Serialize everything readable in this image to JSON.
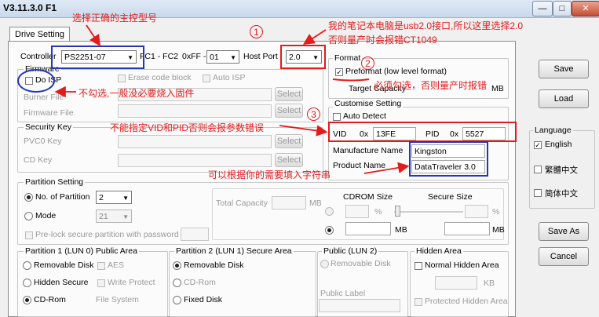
{
  "window": {
    "title": "V3.11.3.0 F1",
    "btn_min": "—",
    "btn_max": "□",
    "btn_close": "✕"
  },
  "tab": {
    "drive_setting": "Drive Setting"
  },
  "controller": {
    "label": "Controller",
    "value": "PS2251-07",
    "fc_label": "FC1 - FC2",
    "hex_label": "0xFF -",
    "fc_value": "01",
    "host_port_label": "Host Port",
    "host_port_value": "2.0"
  },
  "firmware": {
    "group": "Firmware",
    "do_isp": "Do ISP",
    "erase_code_block": "Erase code block",
    "auto_isp": "Auto ISP",
    "burner_file": "Burner File",
    "firmware_file": "Firmware File",
    "select": "Select"
  },
  "security": {
    "group": "Security Key",
    "pvc0_key": "PVC0 Key",
    "cd_key": "CD Key",
    "select": "Select"
  },
  "format": {
    "group": "Format",
    "preformat": "Preformat (low level format)",
    "target_capacity": "Target Capacity",
    "mb": "MB"
  },
  "customise": {
    "group": "Customise Setting",
    "auto_detect": "Auto Detect",
    "vid_label": "VID",
    "vid_prefix": "0x",
    "vid_value": "13FE",
    "pid_label": "PID",
    "pid_prefix": "0x",
    "pid_value": "5527",
    "manufacture_label": "Manufacture Name",
    "manufacture_value": "Kingston",
    "product_label": "Product Name",
    "product_value": "DataTraveler 3.0"
  },
  "partition": {
    "group": "Partition Setting",
    "no_of_partition": "No. of Partition",
    "no_of_partition_value": "2",
    "mode": "Mode",
    "mode_value": "21",
    "total_capacity": "Total Capacity",
    "mb": "MB",
    "cdrom_size": "CDROM Size",
    "secure_size": "Secure Size",
    "percent": "%",
    "pre_lock": "Pre-lock secure partition with password :"
  },
  "lun0": {
    "group": "Partition 1 (LUN 0) Public Area",
    "removable_disk": "Removable Disk",
    "aes": "AES",
    "hidden_secure": "Hidden Secure",
    "write_protect": "Write Protect",
    "cd_rom": "CD-Rom",
    "file_system": "File System"
  },
  "lun1": {
    "group": "Partition 2 (LUN 1) Secure Area",
    "removable_disk": "Removable Disk",
    "cd_rom": "CD-Rom",
    "fixed_disk": "Fixed Disk"
  },
  "lun2": {
    "group": "Public (LUN 2)",
    "removable_disk": "Removable Disk",
    "public_label": "Public Label"
  },
  "hidden": {
    "group": "Hidden Area",
    "normal_hidden": "Normal Hidden Area",
    "kb": "KB",
    "protected_hidden": "Protected Hidden Area"
  },
  "side": {
    "save": "Save",
    "load": "Load",
    "language": "Language",
    "english": "English",
    "trad_chinese": "繁體中文",
    "simp_chinese": "简体中文",
    "save_as": "Save As",
    "cancel": "Cancel"
  },
  "annotations": {
    "select_model": "选择正确的主控型号",
    "usb_note_1": "我的笔记本电脑是usb2.0接口,所以这里选择2.0",
    "usb_note_2": "否则量产时会报错CT1049",
    "no_check": "不勾选,一般没必要烧入固件",
    "must_check": "必须勾选，否则量产时报错",
    "vid_pid_note": "不能指定VID和PID否则会报参数错误",
    "name_note": "可以根据你的需要填入字符串",
    "n1": "1",
    "n2": "2",
    "n3": "3"
  }
}
